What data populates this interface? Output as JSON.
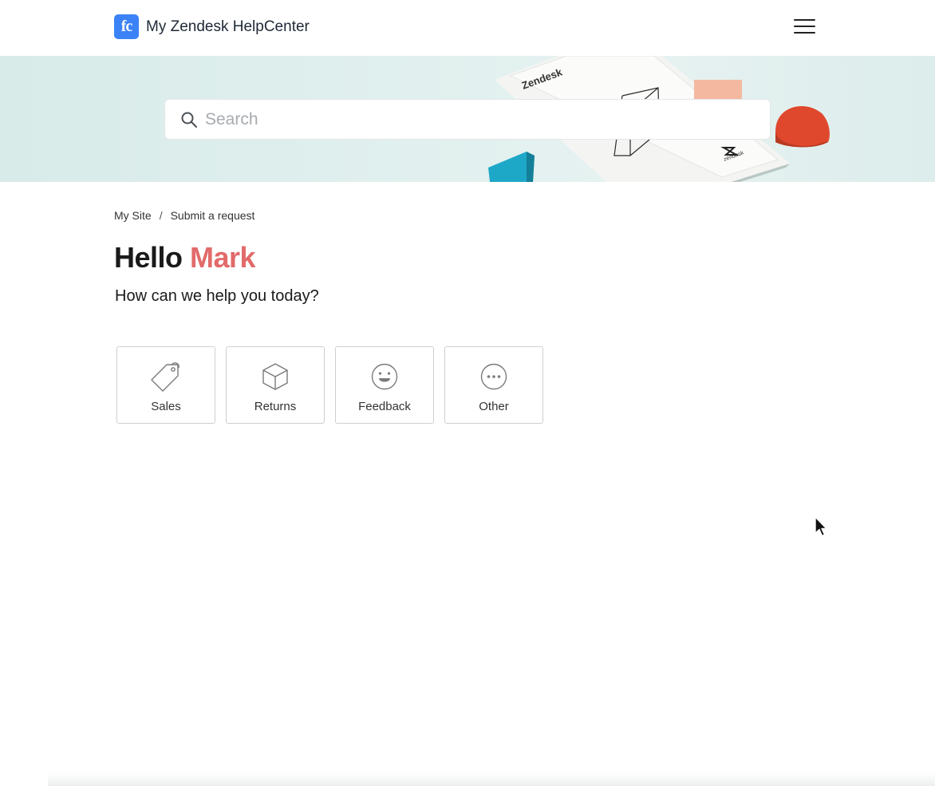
{
  "header": {
    "logo_text": "fc",
    "title": "My Zendesk HelpCenter",
    "menu_icon": "hamburger-icon"
  },
  "hero": {
    "decor_brand_text": "Zendesk",
    "decor_small_text": "zendesk"
  },
  "search": {
    "placeholder": "Search",
    "icon": "search-icon"
  },
  "breadcrumb": {
    "items": [
      "My Site",
      "Submit a request"
    ],
    "separator": "/"
  },
  "greeting": {
    "hello": "Hello",
    "name": "Mark",
    "name_color": "#e26a6a"
  },
  "subtitle": "How can we help you today?",
  "categories": [
    {
      "label": "Sales",
      "icon": "tag-icon"
    },
    {
      "label": "Returns",
      "icon": "box-icon"
    },
    {
      "label": "Feedback",
      "icon": "smiley-icon"
    },
    {
      "label": "Other",
      "icon": "more-icon"
    }
  ],
  "colors": {
    "accent": "#e26a6a",
    "logo": "#3b82f6"
  }
}
